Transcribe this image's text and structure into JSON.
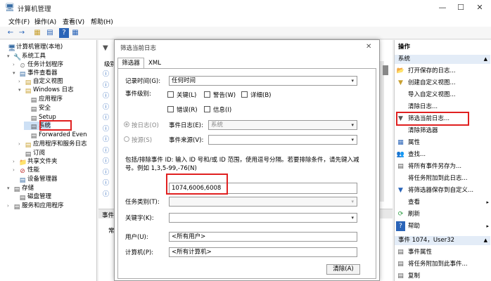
{
  "window": {
    "title": "计算机管理",
    "min": "—",
    "max": "☐",
    "close": "✕"
  },
  "menu": [
    "文件(F)",
    "操作(A)",
    "查看(V)",
    "帮助(H)"
  ],
  "toolbar": [
    "←",
    "→",
    "▦",
    "▤",
    "?",
    "▦"
  ],
  "tree": [
    {
      "label": "计算机管理(本地)",
      "icon": "🖥",
      "arrow": "",
      "indent": 0
    },
    {
      "label": "系统工具",
      "icon": "🔧",
      "arrow": "▾",
      "indent": 1
    },
    {
      "label": "任务计划程序",
      "icon": "⏲",
      "arrow": "›",
      "indent": 2
    },
    {
      "label": "事件查看器",
      "icon": "▤",
      "arrow": "▾",
      "indent": 2
    },
    {
      "label": "自定义视图",
      "icon": "▤",
      "arrow": "›",
      "indent": 3
    },
    {
      "label": "Windows 日志",
      "icon": "▤",
      "arrow": "▾",
      "indent": 3
    },
    {
      "label": "应用程序",
      "icon": "▤",
      "arrow": "",
      "indent": 4
    },
    {
      "label": "安全",
      "icon": "▤",
      "arrow": "",
      "indent": 4
    },
    {
      "label": "Setup",
      "icon": "▤",
      "arrow": "",
      "indent": 4
    },
    {
      "label": "系统",
      "icon": "▤",
      "arrow": "",
      "indent": 4
    },
    {
      "label": "Forwarded Even",
      "icon": "▤",
      "arrow": "",
      "indent": 4
    },
    {
      "label": "应用程序和服务日志",
      "icon": "▤",
      "arrow": "›",
      "indent": 3
    },
    {
      "label": "订阅",
      "icon": "▤",
      "arrow": "",
      "indent": 3
    },
    {
      "label": "共享文件夹",
      "icon": "📁",
      "arrow": "›",
      "indent": 2
    },
    {
      "label": "性能",
      "icon": "⊘",
      "arrow": "›",
      "indent": 2
    },
    {
      "label": "设备管理器",
      "icon": "▤",
      "arrow": "",
      "indent": 2
    },
    {
      "label": "存储",
      "icon": "▤",
      "arrow": "▾",
      "indent": 1
    },
    {
      "label": "磁盘管理",
      "icon": "▤",
      "arrow": "",
      "indent": 2
    },
    {
      "label": "服务和应用程序",
      "icon": "▤",
      "arrow": "›",
      "indent": 1
    }
  ],
  "center": {
    "filter_icon": "▼",
    "col_header": "级别",
    "rows_icon": "ⓘ",
    "bottom_tab": "事件",
    "bottom_label": "常"
  },
  "dialog": {
    "title": "筛选当前日志",
    "close": "✕",
    "tabs": [
      "筛选器",
      "XML"
    ],
    "logged_label": "记录时间(G):",
    "logged_value": "任何时间",
    "level_label": "事件级别:",
    "levels": [
      "关键(L)",
      "警告(W)",
      "详细(B)",
      "错误(R)",
      "信息(I)"
    ],
    "by_log": "按日志(O)",
    "by_source": "按源(S)",
    "event_logs_label": "事件日志(E):",
    "event_logs_value": "系统",
    "event_sources_label": "事件来源(V):",
    "desc": "包括/排除事件 ID: 输入 ID 号和/或 ID 范围，使用逗号分隔。若要排除条件，请先键入减号。例如 1,3,5-99,-76(N)",
    "ids_value": "1074,6006,6008",
    "task_label": "任务类别(T):",
    "keywords_label": "关键字(K):",
    "user_label": "用户(U):",
    "user_value": "<所有用户>",
    "computer_label": "计算机(P):",
    "computer_value": "<所有计算机>",
    "clear_btn": "清除(A)"
  },
  "actions": {
    "header1": "操作",
    "header2": "系统",
    "items": [
      {
        "label": "打开保存的日志...",
        "icon": "📂"
      },
      {
        "label": "创建自定义视图...",
        "icon": "▼"
      },
      {
        "label": "导入自定义视图...",
        "icon": ""
      },
      {
        "label": "清除日志...",
        "icon": ""
      },
      {
        "label": "筛选当前日志...",
        "icon": "▼"
      },
      {
        "label": "清除筛选器",
        "icon": ""
      },
      {
        "label": "属性",
        "icon": "▦"
      },
      {
        "label": "查找...",
        "icon": "👥"
      },
      {
        "label": "将所有事件另存为...",
        "icon": "▤"
      },
      {
        "label": "将任务附加到此日志...",
        "icon": ""
      },
      {
        "label": "将筛选器保存到自定义...",
        "icon": "▼"
      },
      {
        "label": "查看",
        "icon": ""
      },
      {
        "label": "刷新",
        "icon": "⟳"
      },
      {
        "label": "帮助",
        "icon": "?"
      }
    ],
    "submenu_arrow": "▸",
    "header3": "事件 1074，User32",
    "items2": [
      {
        "label": "事件属性",
        "icon": "▤"
      },
      {
        "label": "将任务附加到此事件...",
        "icon": "▤"
      },
      {
        "label": "复制",
        "icon": "▤"
      }
    ]
  }
}
